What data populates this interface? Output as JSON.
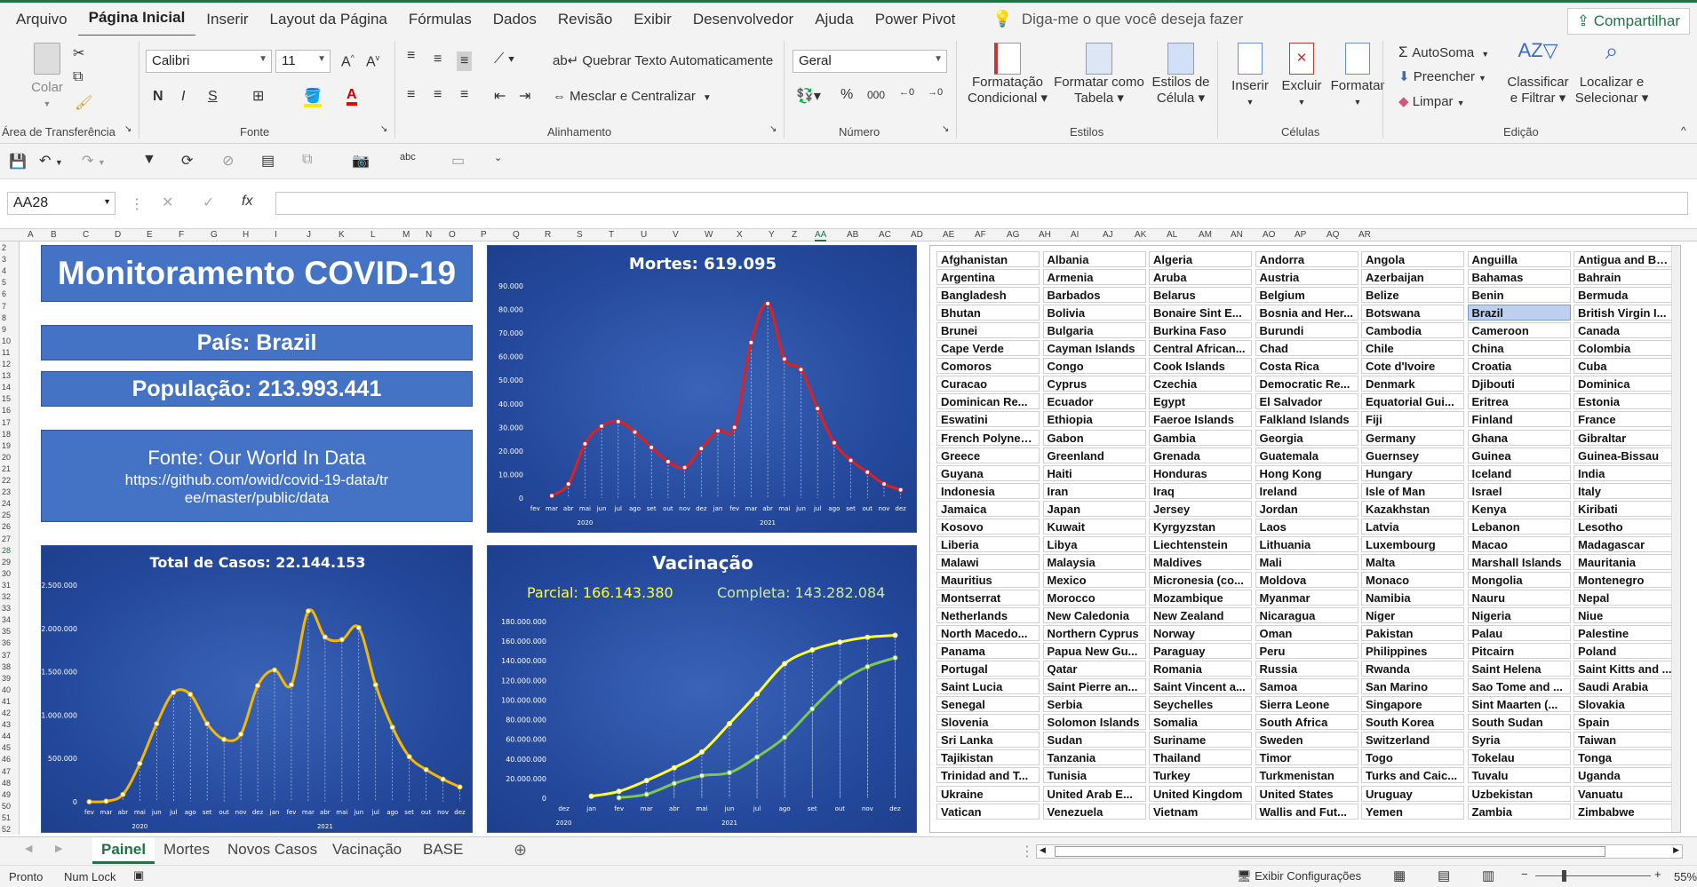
{
  "menu": {
    "items": [
      "Arquivo",
      "Página Inicial",
      "Inserir",
      "Layout da Página",
      "Fórmulas",
      "Dados",
      "Revisão",
      "Exibir",
      "Desenvolvedor",
      "Ajuda",
      "Power Pivot"
    ],
    "tell_me": "Diga-me o que você deseja fazer",
    "share": "Compartilhar"
  },
  "ribbon": {
    "paste": "Colar",
    "clipboard": "Área de Transferência",
    "font_name": "Calibri",
    "font_size": "11",
    "font_group": "Fonte",
    "wrap_text": "Quebrar Texto Automaticamente",
    "merge_center": "Mesclar e Centralizar",
    "alignment_group": "Alinhamento",
    "number_format": "Geral",
    "number_group": "Número",
    "cond_format_1": "Formatação",
    "cond_format_2": "Condicional",
    "format_table_1": "Formatar como",
    "format_table_2": "Tabela",
    "cell_styles_1": "Estilos de",
    "cell_styles_2": "Célula",
    "styles_group": "Estilos",
    "insert": "Inserir",
    "delete": "Excluir",
    "format": "Formatar",
    "cells_group": "Células",
    "autosum": "AutoSoma",
    "fill": "Preencher",
    "clear": "Limpar",
    "sort_1": "Classificar",
    "sort_2": "e Filtrar",
    "find_1": "Localizar e",
    "find_2": "Selecionar",
    "editing_group": "Edição"
  },
  "formula": {
    "cell_ref": "AA28",
    "fx": "fx",
    "value": ""
  },
  "columns": [
    "A",
    "B",
    "C",
    "D",
    "E",
    "F",
    "G",
    "H",
    "I",
    "J",
    "K",
    "L",
    "M",
    "N",
    "O",
    "P",
    "Q",
    "R",
    "S",
    "T",
    "U",
    "V",
    "W",
    "X",
    "Y",
    "Z",
    "AA",
    "AB",
    "AC",
    "AD",
    "AE",
    "AF",
    "AG",
    "AH",
    "AI",
    "AJ",
    "AK",
    "AL",
    "AM",
    "AN",
    "AO",
    "AP",
    "AQ",
    "AR"
  ],
  "dashboard": {
    "title": "Monitoramento COVID-19",
    "country_label": "País:  Brazil",
    "population_label": "População:  213.993.441",
    "source_title": "Fonte: Our World In Data",
    "source_url": "https://github.com/owid/covid-19-data/tree/master/public/data"
  },
  "chart_data": [
    {
      "type": "line",
      "title": "Mortes: 619.095",
      "series": [
        {
          "values": [
            1000,
            6000,
            23000,
            30500,
            32500,
            28000,
            21500,
            15500,
            13000,
            21000,
            28500,
            30000,
            66000,
            82500,
            59000,
            54500,
            38000,
            23500,
            16000,
            11000,
            6000,
            3500
          ]
        }
      ],
      "categories": [
        "fev",
        "mar",
        "abr",
        "mai",
        "jun",
        "jul",
        "ago",
        "set",
        "out",
        "nov",
        "dez",
        "jan",
        "fev",
        "mar",
        "abr",
        "mai",
        "jun",
        "jul",
        "ago",
        "set",
        "out",
        "nov",
        "dez"
      ],
      "x_labels": [
        "fev",
        "mar",
        "abr",
        "mai",
        "jun",
        "jul",
        "ago",
        "set",
        "out",
        "nov",
        "dez",
        "jan",
        "fev",
        "mar",
        "abr",
        "mai",
        "jun",
        "jul",
        "ago",
        "set",
        "out",
        "nov",
        "dez"
      ],
      "years": [
        "2020",
        "2021"
      ],
      "yticks": [
        "90.000",
        "80.000",
        "70.000",
        "60.000",
        "50.000",
        "40.000",
        "30.000",
        "20.000",
        "10.000",
        "0"
      ],
      "ylim": [
        0,
        90000
      ],
      "color": "#e02020"
    },
    {
      "type": "line",
      "title": "Total de Casos: 22.144.153",
      "series": [
        {
          "values": [
            0,
            6000,
            85000,
            440000,
            900000,
            1260000,
            1240000,
            900000,
            720000,
            780000,
            1340000,
            1520000,
            1350000,
            2200000,
            1900000,
            1870000,
            2010000,
            1350000,
            860000,
            520000,
            370000,
            260000,
            170000
          ]
        }
      ],
      "x_labels": [
        "fev",
        "mar",
        "abr",
        "mai",
        "jun",
        "jul",
        "ago",
        "set",
        "out",
        "nov",
        "dez",
        "jan",
        "fev",
        "mar",
        "abr",
        "mai",
        "jun",
        "jul",
        "ago",
        "set",
        "out",
        "nov",
        "dez"
      ],
      "years": [
        "2020",
        "2021"
      ],
      "yticks": [
        "2.500.000",
        "2.000.000",
        "1.500.000",
        "1.000.000",
        "500.000",
        "0"
      ],
      "ylim": [
        0,
        2500000
      ],
      "color": "#f5b800"
    },
    {
      "type": "line",
      "title": "Vacinação",
      "parcial_label": "Parcial: 166.143.380",
      "completa_label": "Completa: 143.282.084",
      "x_labels": [
        "dez",
        "jan",
        "fev",
        "mar",
        "abr",
        "mai",
        "jun",
        "jul",
        "ago",
        "set",
        "out",
        "nov",
        "dez"
      ],
      "years": [
        "2020",
        "2021"
      ],
      "yticks": [
        "180.000.000",
        "160.000.000",
        "140.000.000",
        "120.000.000",
        "100.000.000",
        "80.000.000",
        "60.000.000",
        "40.000.000",
        "20.000.000",
        "0"
      ],
      "ylim": [
        0,
        180000000
      ],
      "series": [
        {
          "name": "Parcial",
          "color": "#ffff33",
          "values": [
            null,
            2000000,
            7000000,
            18000000,
            31000000,
            47000000,
            76000000,
            106000000,
            137000000,
            151000000,
            159000000,
            164000000,
            166000000
          ]
        },
        {
          "name": "Completa",
          "color": "#7ec850",
          "values": [
            null,
            null,
            500000,
            4000000,
            15000000,
            23000000,
            26000000,
            42000000,
            62000000,
            91000000,
            118000000,
            134000000,
            143000000
          ]
        }
      ]
    }
  ],
  "countries": [
    "Afghanistan",
    "Albania",
    "Algeria",
    "Andorra",
    "Angola",
    "Anguilla",
    "Antigua and Ba...",
    "Argentina",
    "Armenia",
    "Aruba",
    "Austria",
    "Azerbaijan",
    "Bahamas",
    "Bahrain",
    "Bangladesh",
    "Barbados",
    "Belarus",
    "Belgium",
    "Belize",
    "Benin",
    "Bermuda",
    "Bhutan",
    "Bolivia",
    "Bonaire Sint E...",
    "Bosnia and Her...",
    "Botswana",
    "Brazil",
    "British Virgin I...",
    "Brunei",
    "Bulgaria",
    "Burkina Faso",
    "Burundi",
    "Cambodia",
    "Cameroon",
    "Canada",
    "Cape Verde",
    "Cayman Islands",
    "Central African...",
    "Chad",
    "Chile",
    "China",
    "Colombia",
    "Comoros",
    "Congo",
    "Cook Islands",
    "Costa Rica",
    "Cote d'Ivoire",
    "Croatia",
    "Cuba",
    "Curacao",
    "Cyprus",
    "Czechia",
    "Democratic Re...",
    "Denmark",
    "Djibouti",
    "Dominica",
    "Dominican Re...",
    "Ecuador",
    "Egypt",
    "El Salvador",
    "Equatorial Gui...",
    "Eritrea",
    "Estonia",
    "Eswatini",
    "Ethiopia",
    "Faeroe Islands",
    "Falkland Islands",
    "Fiji",
    "Finland",
    "France",
    "French Polynesia",
    "Gabon",
    "Gambia",
    "Georgia",
    "Germany",
    "Ghana",
    "Gibraltar",
    "Greece",
    "Greenland",
    "Grenada",
    "Guatemala",
    "Guernsey",
    "Guinea",
    "Guinea-Bissau",
    "Guyana",
    "Haiti",
    "Honduras",
    "Hong Kong",
    "Hungary",
    "Iceland",
    "India",
    "Indonesia",
    "Iran",
    "Iraq",
    "Ireland",
    "Isle of Man",
    "Israel",
    "Italy",
    "Jamaica",
    "Japan",
    "Jersey",
    "Jordan",
    "Kazakhstan",
    "Kenya",
    "Kiribati",
    "Kosovo",
    "Kuwait",
    "Kyrgyzstan",
    "Laos",
    "Latvia",
    "Lebanon",
    "Lesotho",
    "Liberia",
    "Libya",
    "Liechtenstein",
    "Lithuania",
    "Luxembourg",
    "Macao",
    "Madagascar",
    "Malawi",
    "Malaysia",
    "Maldives",
    "Mali",
    "Malta",
    "Marshall Islands",
    "Mauritania",
    "Mauritius",
    "Mexico",
    "Micronesia (co...",
    "Moldova",
    "Monaco",
    "Mongolia",
    "Montenegro",
    "Montserrat",
    "Morocco",
    "Mozambique",
    "Myanmar",
    "Namibia",
    "Nauru",
    "Nepal",
    "Netherlands",
    "New Caledonia",
    "New Zealand",
    "Nicaragua",
    "Niger",
    "Nigeria",
    "Niue",
    "North Macedo...",
    "Northern Cyprus",
    "Norway",
    "Oman",
    "Pakistan",
    "Palau",
    "Palestine",
    "Panama",
    "Papua New Gu...",
    "Paraguay",
    "Peru",
    "Philippines",
    "Pitcairn",
    "Poland",
    "Portugal",
    "Qatar",
    "Romania",
    "Russia",
    "Rwanda",
    "Saint Helena",
    "Saint Kitts and ...",
    "Saint Lucia",
    "Saint Pierre an...",
    "Saint Vincent a...",
    "Samoa",
    "San Marino",
    "Sao Tome and ...",
    "Saudi Arabia",
    "Senegal",
    "Serbia",
    "Seychelles",
    "Sierra Leone",
    "Singapore",
    "Sint Maarten (...",
    "Slovakia",
    "Slovenia",
    "Solomon Islands",
    "Somalia",
    "South Africa",
    "South Korea",
    "South Sudan",
    "Spain",
    "Sri Lanka",
    "Sudan",
    "Suriname",
    "Sweden",
    "Switzerland",
    "Syria",
    "Taiwan",
    "Tajikistan",
    "Tanzania",
    "Thailand",
    "Timor",
    "Togo",
    "Tokelau",
    "Tonga",
    "Trinidad and T...",
    "Tunisia",
    "Turkey",
    "Turkmenistan",
    "Turks and Caic...",
    "Tuvalu",
    "Uganda",
    "Ukraine",
    "United Arab E...",
    "United Kingdom",
    "United States",
    "Uruguay",
    "Uzbekistan",
    "Vanuatu",
    "Vatican",
    "Venezuela",
    "Vietnam",
    "Wallis and Fut...",
    "Yemen",
    "Zambia",
    "Zimbabwe"
  ],
  "selected_country": "Brazil",
  "sheets": [
    "Painel",
    "Mortes",
    "Novos Casos",
    "Vacinação",
    "BASE"
  ],
  "active_sheet": "Painel",
  "status": {
    "ready": "Pronto",
    "num_lock": "Num Lock",
    "display_settings": "Exibir Configurações",
    "zoom": "55%"
  }
}
